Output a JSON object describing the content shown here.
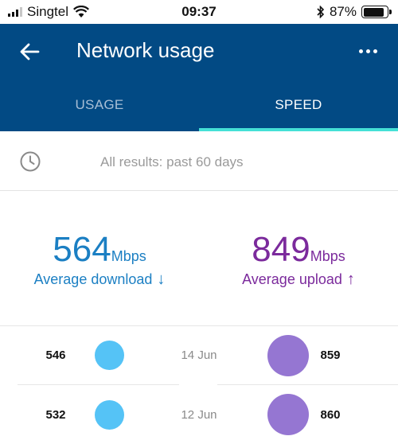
{
  "status_bar": {
    "carrier": "Singtel",
    "time": "09:37",
    "battery": "87%",
    "battery_level": 0.87
  },
  "header": {
    "title": "Network usage",
    "tabs": [
      {
        "label": "USAGE",
        "active": false
      },
      {
        "label": "SPEED",
        "active": true
      }
    ]
  },
  "filter": {
    "text": "All results: past 60 days"
  },
  "summary": {
    "download": {
      "value": "564",
      "unit": "Mbps",
      "label": "Average download",
      "arrow": "↓"
    },
    "upload": {
      "value": "849",
      "unit": "Mbps",
      "label": "Average upload",
      "arrow": "↑"
    }
  },
  "results": [
    {
      "date": "14 Jun",
      "download": "546",
      "upload": "859"
    },
    {
      "date": "12 Jun",
      "download": "532",
      "upload": "860"
    }
  ],
  "colors": {
    "header_bg": "#024a84",
    "tab_indicator": "#45e0d6",
    "download": "#1b7fc3",
    "upload": "#7b2a9c",
    "download_dot": "#55c3f6",
    "upload_dot": "#9576d2"
  }
}
